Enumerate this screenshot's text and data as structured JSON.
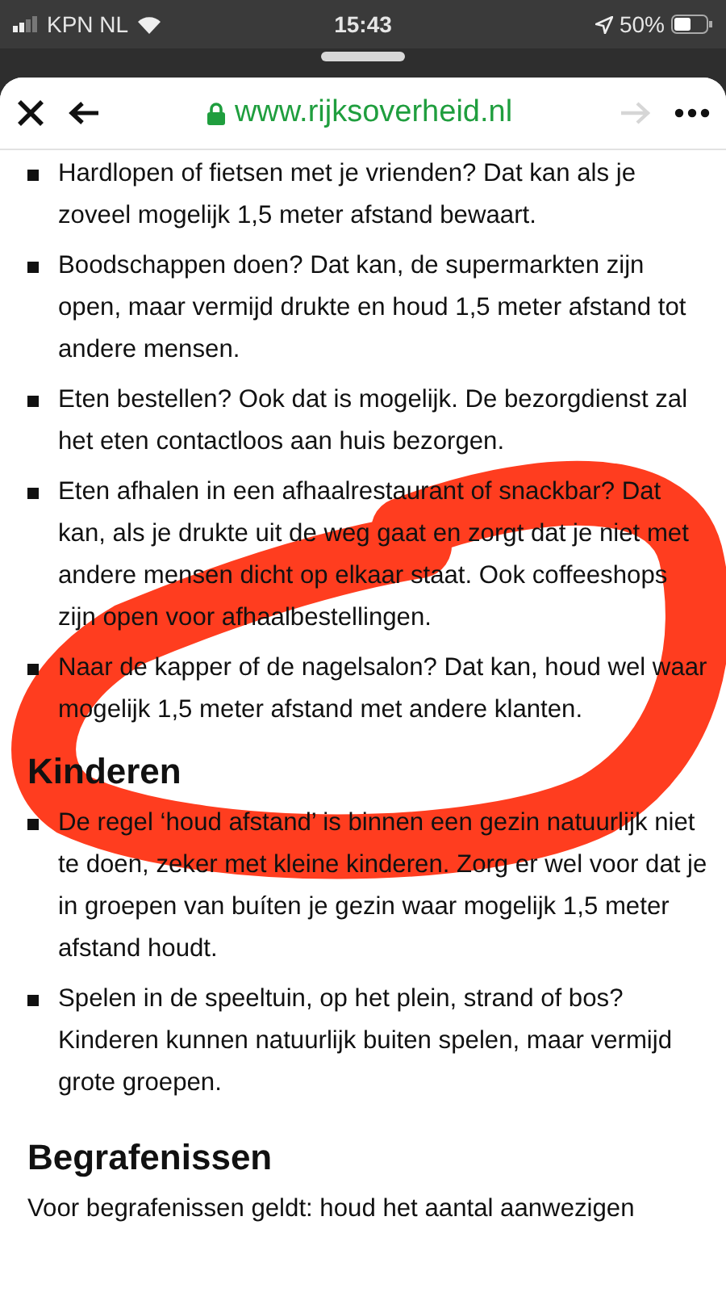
{
  "status_bar": {
    "carrier": "KPN NL",
    "time": "15:43",
    "battery": "50%"
  },
  "browser_bar": {
    "url": "www.rijksoverheid.nl",
    "forward_disabled": true
  },
  "sections": [
    {
      "kind": "list",
      "items": [
        "Hardlopen of fietsen met je vrienden? Dat kan als je zoveel mogelijk 1,5 meter afstand bewaart.",
        "Boodschappen doen? Dat kan, de supermarkten zijn open, maar vermijd drukte en houd 1,5 meter afstand tot andere mensen.",
        "Eten bestellen? Ook dat is mogelijk. De bezorgdienst zal het eten contactloos aan huis bezorgen.",
        "Eten afhalen in een afhaalrestaurant of snackbar? Dat kan, als je drukte uit de weg gaat en zorgt dat je niet met andere mensen dicht op elkaar staat. Ook coffeeshops zijn open voor afhaalbestellingen.",
        "Naar de kapper of de nagelsalon? Dat kan, houd wel waar mogelijk 1,5 meter afstand met andere klanten."
      ]
    },
    {
      "kind": "heading",
      "text": "Kinderen"
    },
    {
      "kind": "list",
      "items": [
        "De regel ‘houd afstand’ is binnen een gezin natuurlijk niet te doen, zeker met kleine kinderen. Zorg er wel voor dat je in groepen van buíten je gezin waar mogelijk 1,5 meter afstand houdt.",
        "Spelen in de speeltuin, op het plein, strand of bos? Kinderen kunnen natuurlijk buiten spelen, maar vermijd grote groepen."
      ]
    },
    {
      "kind": "heading",
      "text": "Begrafenissen"
    },
    {
      "kind": "paragraph",
      "text": "Voor begrafenissen geldt: houd het aantal aanwezigen"
    }
  ],
  "annotation": {
    "kind": "scribble",
    "color": "#ff3d1f"
  }
}
